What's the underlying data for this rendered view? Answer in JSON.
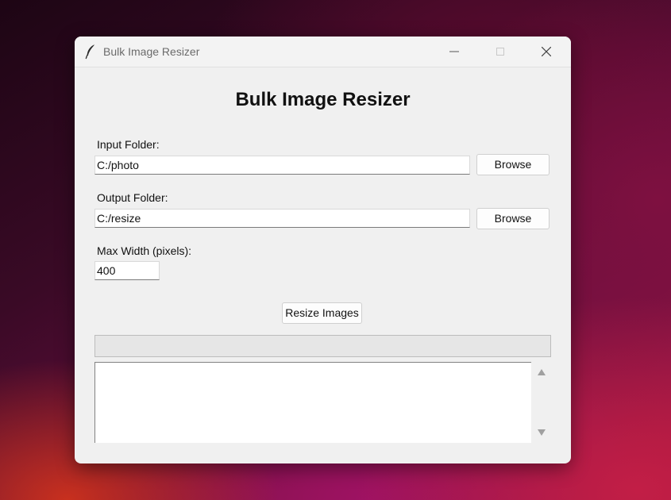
{
  "window": {
    "title": "Bulk Image Resizer",
    "icon": "feather-icon"
  },
  "main": {
    "heading": "Bulk Image Resizer",
    "input_folder": {
      "label": "Input Folder:",
      "value": "C:/photo",
      "browse_label": "Browse"
    },
    "output_folder": {
      "label": "Output Folder:",
      "value": "C:/resize",
      "browse_label": "Browse"
    },
    "max_width": {
      "label": "Max Width (pixels):",
      "value": "400"
    },
    "resize_button_label": "Resize Images",
    "progress": {
      "fraction": 0
    },
    "log_text": ""
  }
}
